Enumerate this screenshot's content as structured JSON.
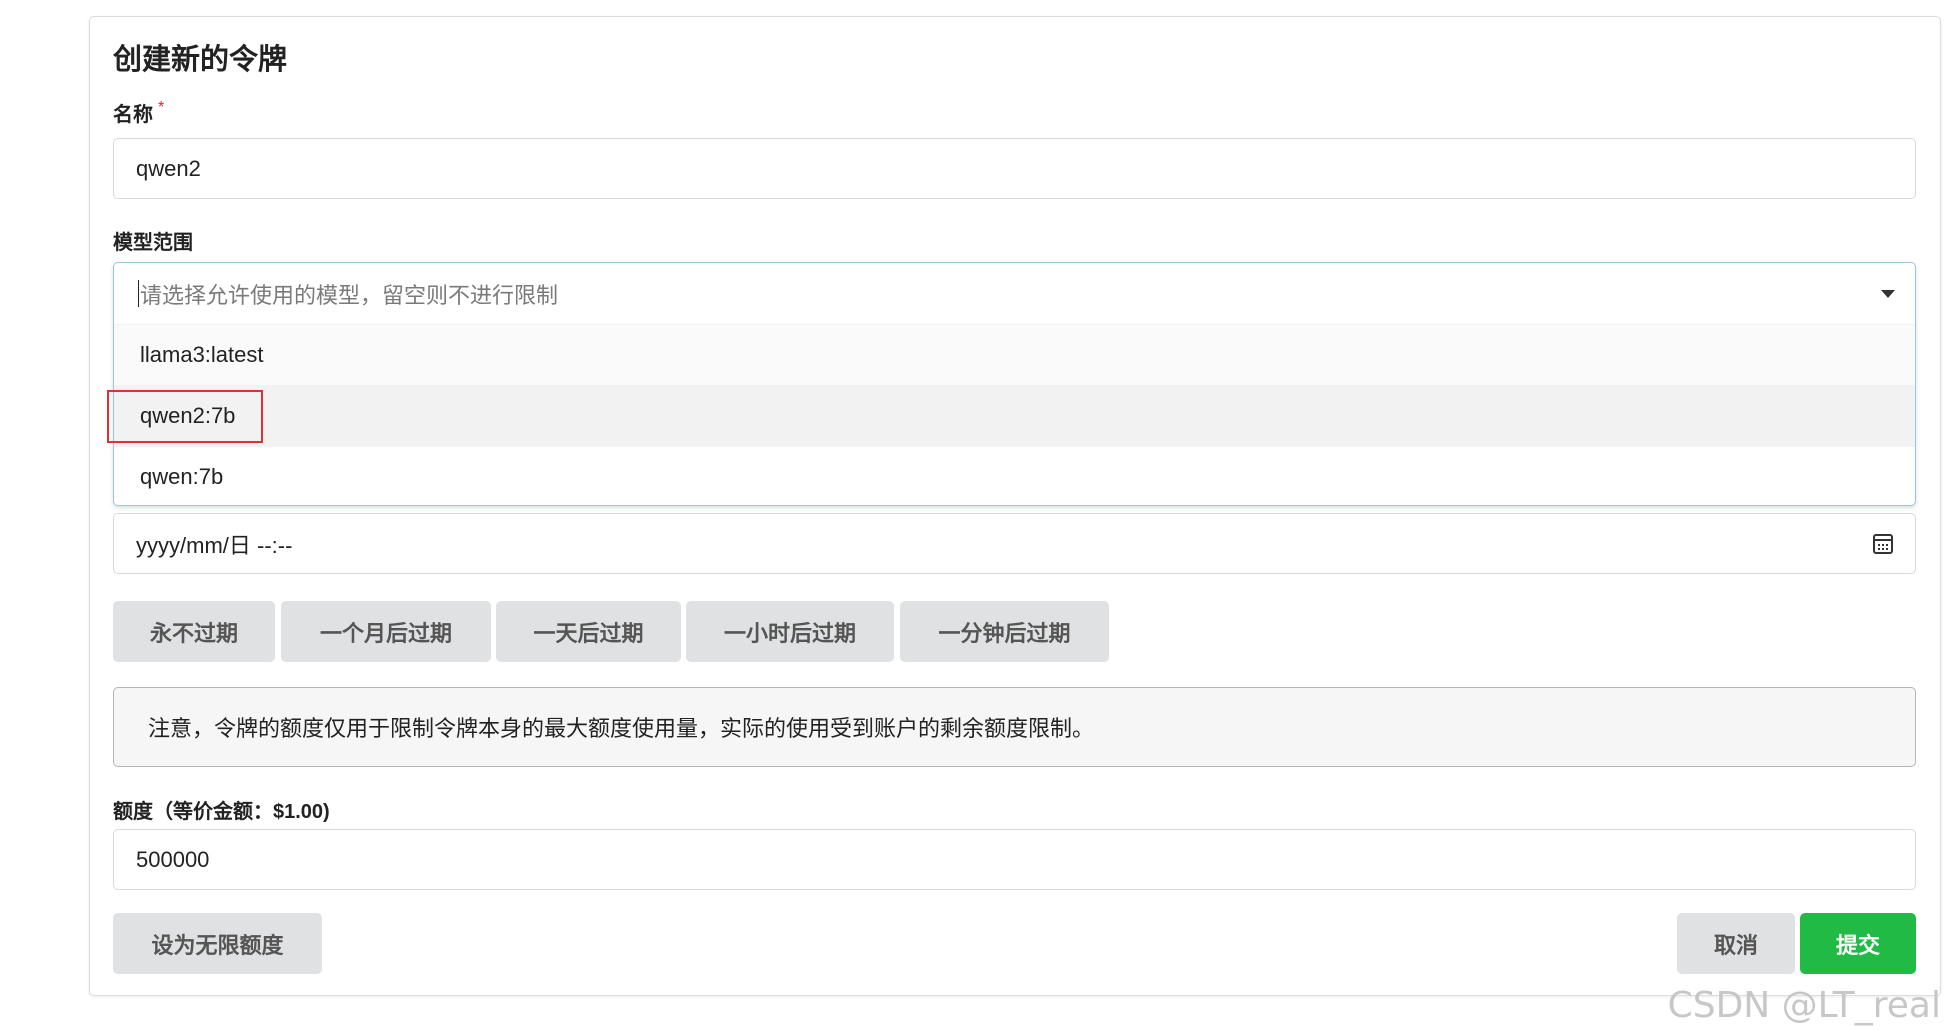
{
  "form": {
    "title": "创建新的令牌",
    "name_label": "名称",
    "required_mark": "*",
    "name_value": "qwen2",
    "model_scope_label": "模型范围",
    "model_placeholder": "请选择允许使用的模型，留空则不进行限制",
    "model_options": [
      "llama3:latest",
      "qwen2:7b",
      "qwen:7b"
    ],
    "hovered_option": "qwen2:7b",
    "expire_value": "yyyy/mm/日 --:--",
    "expire_buttons": [
      "永不过期",
      "一个月后过期",
      "一天后过期",
      "一小时后过期",
      "一分钟后过期"
    ],
    "notice": "注意，令牌的额度仅用于限制令牌本身的最大额度使用量，实际的使用受到账户的剩余额度限制。",
    "quota_label": "额度（等价金额：$1.00)",
    "quota_value": "500000",
    "unlimited_button": "设为无限额度",
    "cancel_button": "取消",
    "submit_button": "提交"
  },
  "watermark": "CSDN @LT_real",
  "colors": {
    "submit": "#21ba45",
    "highlight": "#e03131",
    "dropdown_border": "#96c8da"
  },
  "icons": {
    "dropdown_caret": "chevron-down-icon",
    "calendar": "calendar-icon"
  }
}
